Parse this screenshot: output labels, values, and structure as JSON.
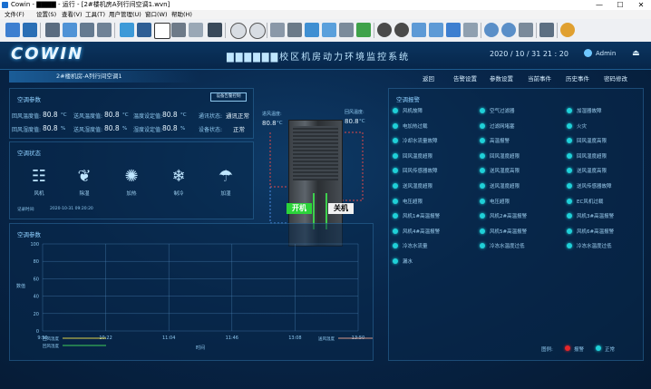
{
  "window": {
    "title": "Cowin - ▇▇▇▇ - 运行 - [2#楼机房A列行间空调1.wvn]",
    "minimize": "—",
    "maximize": "☐",
    "close": "✕"
  },
  "menu": [
    "文件(F)",
    "设置(S)",
    "查看(V)",
    "工具(T)",
    "用户管理(U)",
    "窗口(W)",
    "帮助(H)"
  ],
  "header": {
    "logo": "COWIN",
    "title": "▇▇▇▇▇▇校区机房动力环境监控系统",
    "time": "2020 / 10 / 31   21 : 20",
    "user": "Admin"
  },
  "subnav": {
    "current_page": "2#楼机房-A列行间空调1",
    "links": [
      "返回",
      "告警设置",
      "参数设置",
      "当前事件",
      "历史事件",
      "密码修改"
    ]
  },
  "params_panel": {
    "title": "空调参数",
    "mode_button": "设备告警控制",
    "rows": [
      [
        {
          "label": "回风温度值:",
          "value": "80.8",
          "unit": "°C"
        },
        {
          "label": "送风温度值:",
          "value": "80.8",
          "unit": "°C"
        },
        {
          "label": "温度设定值:",
          "value": "80.8",
          "unit": "°C"
        },
        {
          "label": "通讯状态:",
          "value": "通讯正常",
          "unit": ""
        }
      ],
      [
        {
          "label": "回风湿度值:",
          "value": "80.8",
          "unit": "%"
        },
        {
          "label": "送风湿度值:",
          "value": "80.8",
          "unit": "%"
        },
        {
          "label": "湿度设定值:",
          "value": "80.8",
          "unit": "%"
        },
        {
          "label": "设备状态:",
          "value": "正常",
          "unit": ""
        }
      ]
    ]
  },
  "status_panel": {
    "title": "空调状态",
    "items": [
      {
        "label": "风机",
        "icon": "fan-icon"
      },
      {
        "label": "除湿",
        "icon": "dehumidify-icon"
      },
      {
        "label": "加热",
        "icon": "heat-icon"
      },
      {
        "label": "制冷",
        "icon": "cooling-icon"
      },
      {
        "label": "加湿",
        "icon": "humidify-icon"
      }
    ],
    "record_label": "记录时间:",
    "record_time": "2020-10-31 09:20:20"
  },
  "unit_view": {
    "inlet_label": "进风温度:",
    "inlet_value": "80.8",
    "inlet_unit": "°C",
    "outlet_label": "回风温度:",
    "outlet_value": "80.8",
    "outlet_unit": "°C",
    "on_label": "开机",
    "off_label": "关机"
  },
  "chart_panel": {
    "title": "空调参数"
  },
  "chart_data": {
    "type": "line",
    "x_ticks": [
      "9:50",
      "10:22",
      "11:04",
      "11:46",
      "13:08",
      "13:50"
    ],
    "x_center_label": "时间",
    "ylim": [
      0,
      100
    ],
    "y_ticks": [
      0,
      20,
      40,
      60,
      80,
      100
    ],
    "ylabel": "数值",
    "series": [
      {
        "name": "回风温度",
        "color": "#e0d24a",
        "values": []
      },
      {
        "name": "回风湿度",
        "color": "#3fcf5a",
        "values": []
      },
      {
        "name": "送风温度",
        "color": "#d89a8a",
        "values": []
      }
    ],
    "grid": true
  },
  "alarm_panel": {
    "title": "空调报警",
    "items": [
      "风机故障",
      "空气过滤器",
      "加湿器故障",
      "电加热过载",
      "过滤网堵塞",
      "火灾",
      "冷却水流量故障",
      "高温报警",
      "回风温度高限",
      "回风温度超限",
      "回风湿度超限",
      "回风湿度超限",
      "回风传感器故障",
      "送风湿度高限",
      "送风温度高限",
      "送风湿度超限",
      "送风湿度超限",
      "送风传感器故障",
      "电压超限",
      "电压超限",
      "EC风机过载",
      "风机1#高温报警",
      "风机2#高温报警",
      "风机3#高温报警",
      "风机4#高温报警",
      "风机5#高温报警",
      "风机6#高温报警",
      "冷冻水流量",
      "冷冻水温度过低",
      "冷冻水温度过低",
      "漏水"
    ],
    "legend_label": "图例:",
    "legend_alarm": "报警",
    "legend_normal": "正常",
    "alarm_color": "#e5262a",
    "normal_color": "#1fd0d8"
  }
}
